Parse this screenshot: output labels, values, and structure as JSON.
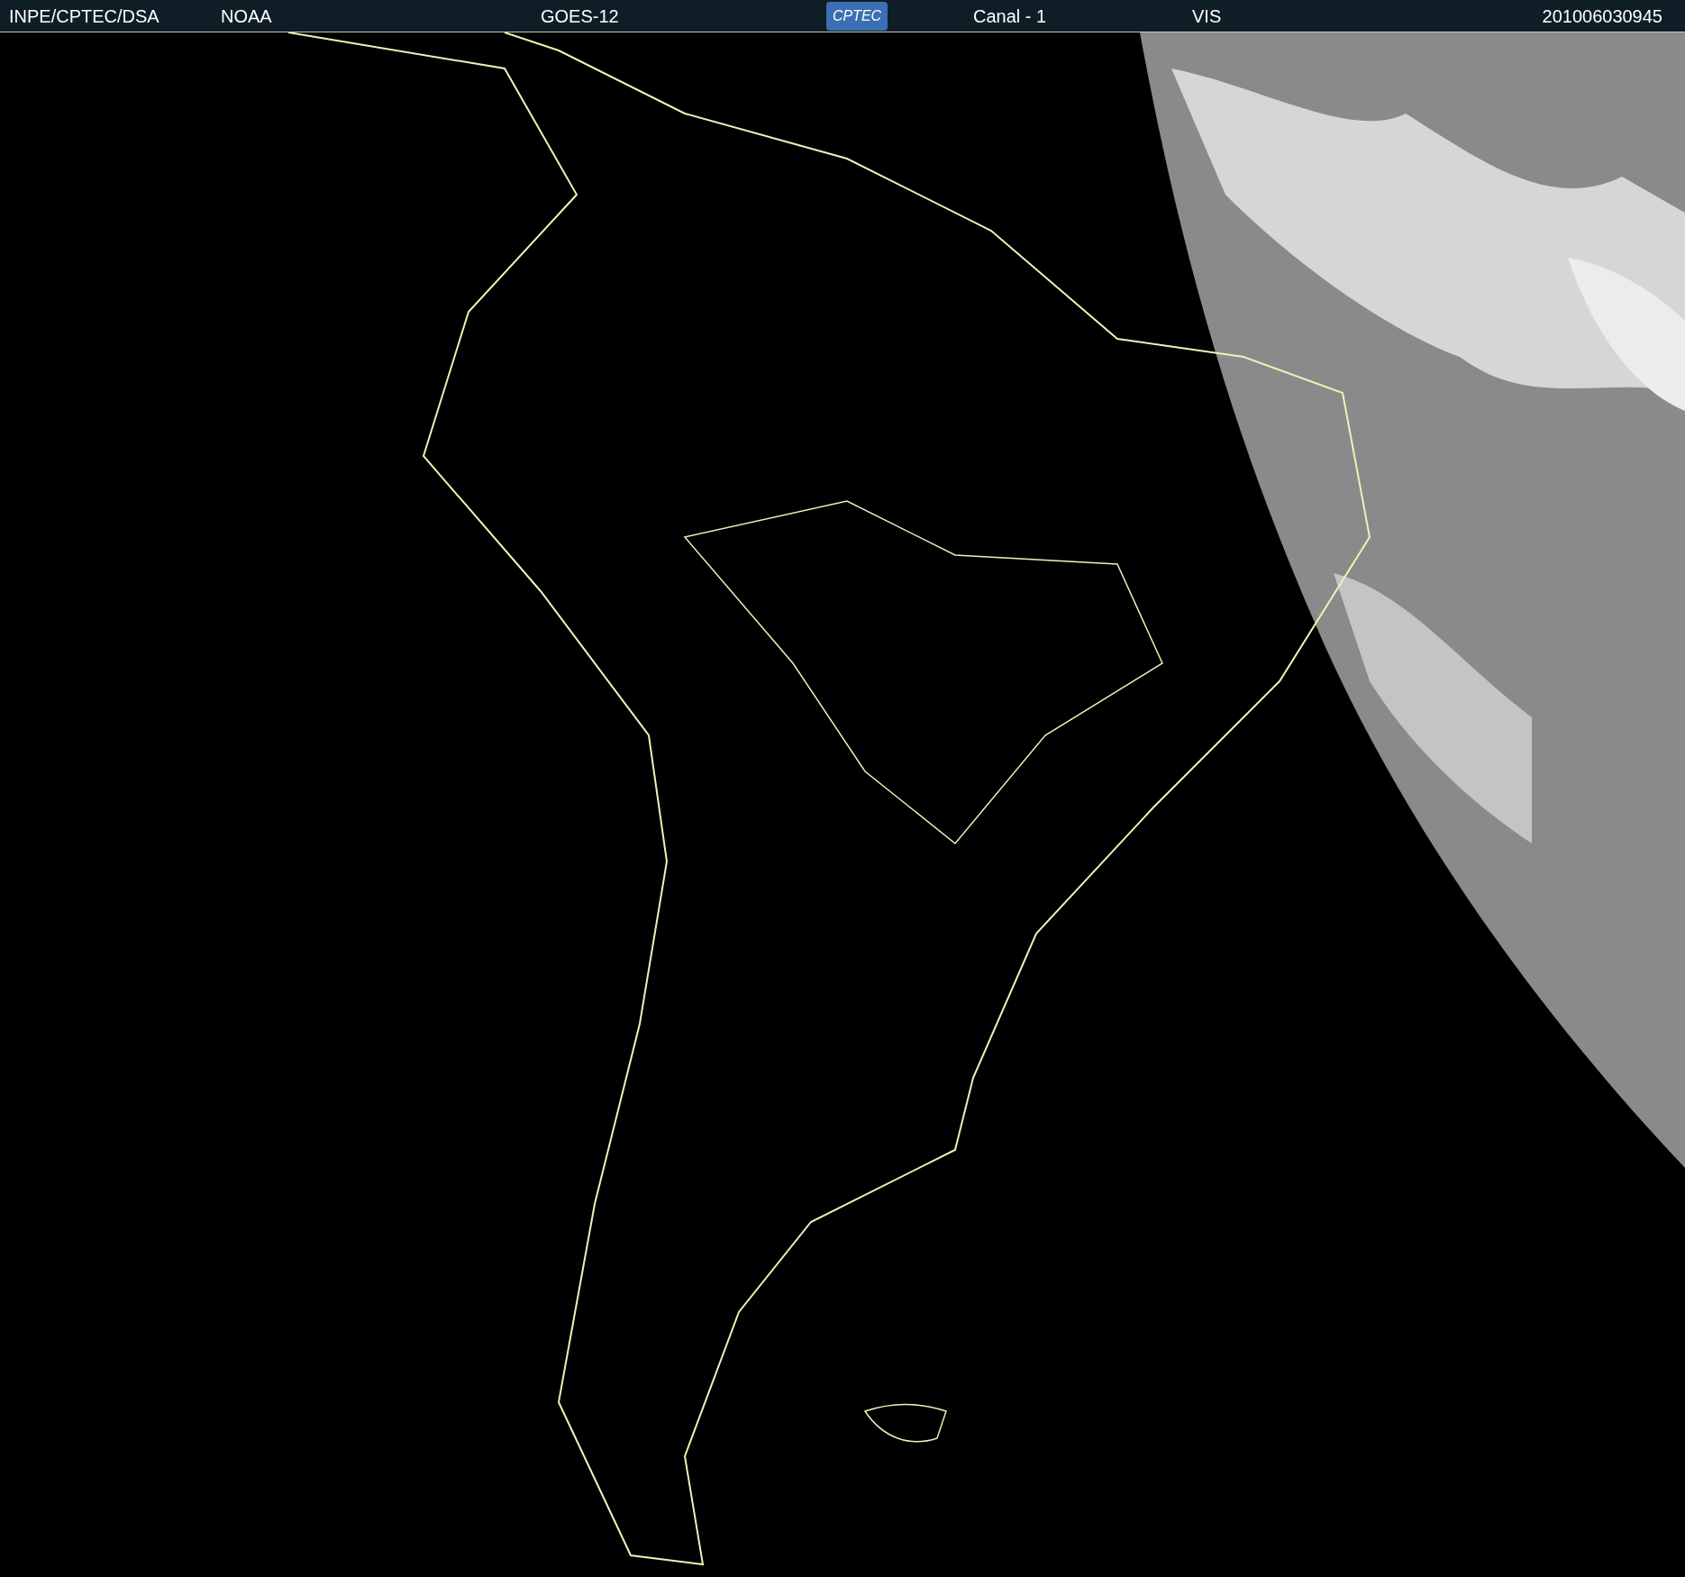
{
  "header": {
    "source": "INPE/CPTEC/DSA",
    "agency": "NOAA",
    "satellite": "GOES-12",
    "logo": "CPTEC",
    "channel": "Canal - 1",
    "band": "VIS",
    "timestamp": "201006030945"
  }
}
